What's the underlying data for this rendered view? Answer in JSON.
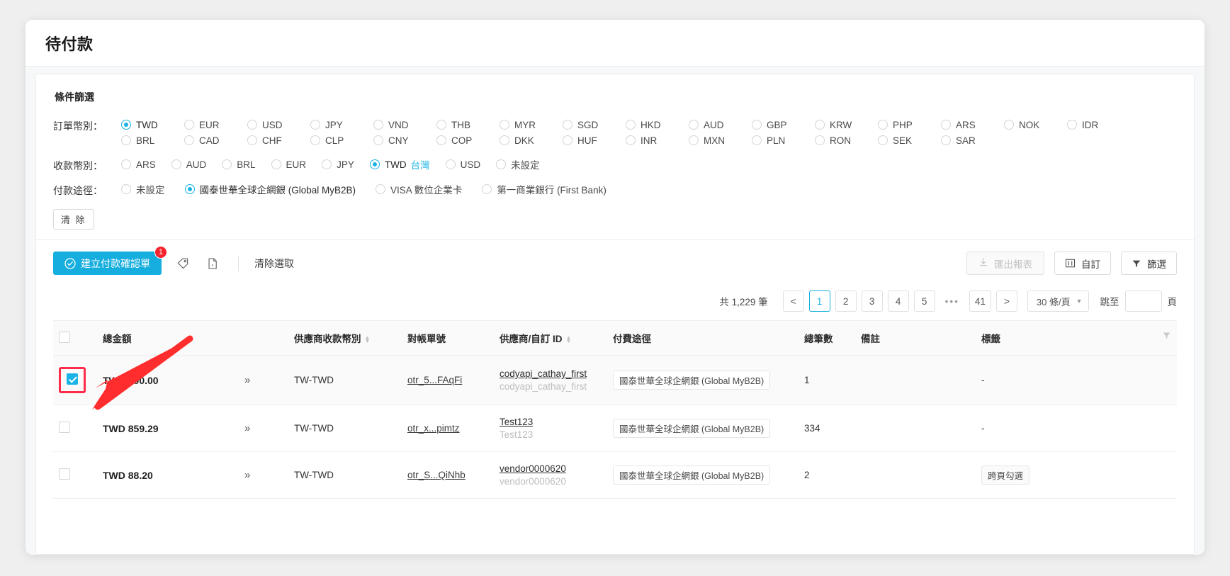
{
  "window": {
    "title": "待付款"
  },
  "filters": {
    "section_title": "條件篩選",
    "order_currency": {
      "label": "訂單幣別：",
      "selected": "TWD",
      "options": [
        "TWD",
        "EUR",
        "USD",
        "JPY",
        "VND",
        "THB",
        "MYR",
        "SGD",
        "HKD",
        "AUD",
        "GBP",
        "KRW",
        "PHP",
        "ARS",
        "NOK",
        "IDR",
        "BRL",
        "CAD",
        "CHF",
        "CLP",
        "CNY",
        "COP",
        "DKK",
        "HUF",
        "INR",
        "MXN",
        "PLN",
        "RON",
        "SEK",
        "SAR"
      ]
    },
    "receive_currency": {
      "label": "收款幣別：",
      "selected": "TWD",
      "selected_note": "台灣",
      "options": [
        "ARS",
        "AUD",
        "BRL",
        "EUR",
        "JPY",
        "TWD",
        "USD",
        "未設定"
      ]
    },
    "payment_channel": {
      "label": "付款途徑：",
      "selected": "國泰世華全球企網銀 (Global MyB2B)",
      "options": [
        "未設定",
        "國泰世華全球企網銀 (Global MyB2B)",
        "VISA 數位企業卡",
        "第一商業銀行 (First Bank)"
      ]
    },
    "clear_button": "清 除"
  },
  "toolbar": {
    "primary_label": "建立付款確認單",
    "primary_badge": "1",
    "tag_icon": "tag-icon",
    "export_file_icon": "file-excel-icon",
    "clear_selection": "清除選取",
    "export_report": "匯出報表",
    "customize": "自訂",
    "filter": "篩選"
  },
  "pagination": {
    "total_text": "共 1,229 筆",
    "prev": "<",
    "next": ">",
    "pages": [
      "1",
      "2",
      "3",
      "4",
      "5"
    ],
    "ellipsis": "•••",
    "last_page": "41",
    "current": "1",
    "page_size": "30 條/頁",
    "jump_label": "跳至",
    "jump_value": "",
    "jump_suffix": "頁"
  },
  "table": {
    "columns": [
      {
        "key": "checkbox",
        "label": "",
        "sortable": false
      },
      {
        "key": "amount",
        "label": "總金額",
        "sortable": false
      },
      {
        "key": "expand",
        "label": "",
        "sortable": false
      },
      {
        "key": "vendor_currency",
        "label": "供應商收款幣別",
        "sortable": true
      },
      {
        "key": "statement_no",
        "label": "對帳單號",
        "sortable": false
      },
      {
        "key": "vendor_id",
        "label": "供應商/自訂 ID",
        "sortable": true
      },
      {
        "key": "pay_channel",
        "label": "付費途徑",
        "sortable": false
      },
      {
        "key": "count",
        "label": "總筆數",
        "sortable": false
      },
      {
        "key": "note",
        "label": "備註",
        "sortable": false
      },
      {
        "key": "tags",
        "label": "標籤",
        "sortable": false
      }
    ],
    "rows": [
      {
        "checked": true,
        "highlighted": true,
        "amount": "TWD 200.00",
        "expand": "»",
        "vendor_currency": "TW-TWD",
        "statement_no": "otr_5...FAqFi",
        "vendor_id_main": "codyapi_cathay_first",
        "vendor_id_sub": "codyapi_cathay_first",
        "pay_channel": "國泰世華全球企網銀 (Global MyB2B)",
        "count": "1",
        "note": "",
        "tags": "-"
      },
      {
        "checked": false,
        "highlighted": false,
        "amount": "TWD 859.29",
        "expand": "»",
        "vendor_currency": "TW-TWD",
        "statement_no": "otr_x...pimtz",
        "vendor_id_main": "Test123",
        "vendor_id_sub": "Test123",
        "pay_channel": "國泰世華全球企網銀 (Global MyB2B)",
        "count": "334",
        "note": "",
        "tags": "-"
      },
      {
        "checked": false,
        "highlighted": false,
        "amount": "TWD 88.20",
        "expand": "»",
        "vendor_currency": "TW-TWD",
        "statement_no": "otr_S...QiNhb",
        "vendor_id_main": "vendor0000620",
        "vendor_id_sub": "vendor0000620",
        "pay_channel": "國泰世華全球企網銀 (Global MyB2B)",
        "count": "2",
        "note": "",
        "tags": "跨頁勾選"
      }
    ]
  },
  "colors": {
    "accent": "#16aede",
    "badge": "#f5222d",
    "highlight": "#ff2d4a"
  }
}
